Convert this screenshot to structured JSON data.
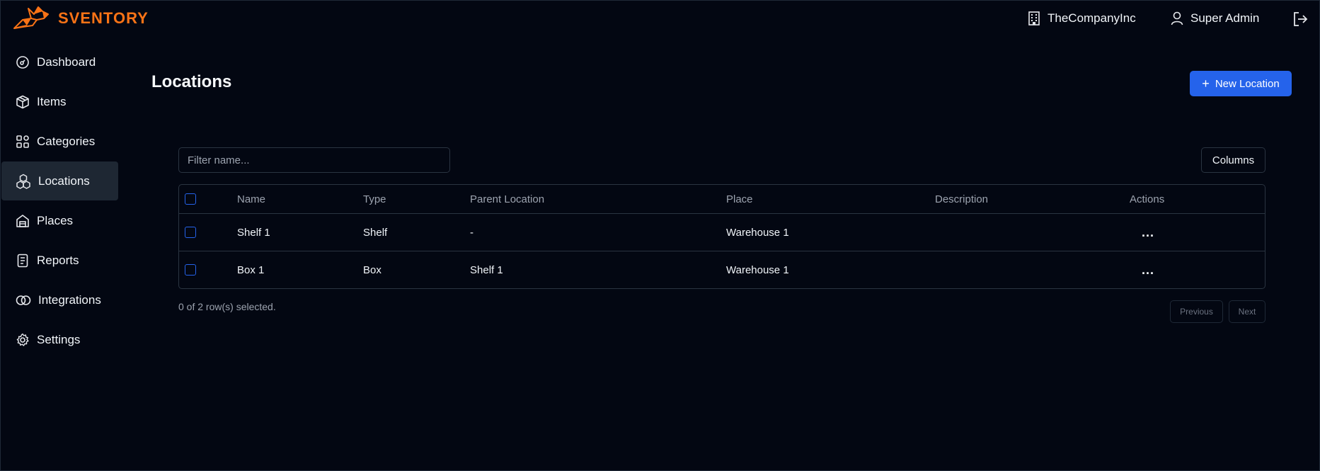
{
  "brand": {
    "name": "SVENTORY",
    "color": "#f97316"
  },
  "header": {
    "company": "TheCompanyInc",
    "user": "Super Admin",
    "icons": {
      "company": "building-icon",
      "user": "user-icon",
      "logout": "logout-icon"
    }
  },
  "sidebar": {
    "items": [
      {
        "label": "Dashboard",
        "icon": "gauge-icon",
        "active": false
      },
      {
        "label": "Items",
        "icon": "box-icon",
        "active": false
      },
      {
        "label": "Categories",
        "icon": "grid-icon",
        "active": false
      },
      {
        "label": "Locations",
        "icon": "boxes-icon",
        "active": true
      },
      {
        "label": "Places",
        "icon": "warehouse-icon",
        "active": false
      },
      {
        "label": "Reports",
        "icon": "report-icon",
        "active": false
      },
      {
        "label": "Integrations",
        "icon": "link-icon",
        "active": false
      },
      {
        "label": "Settings",
        "icon": "gear-icon",
        "active": false
      }
    ]
  },
  "main": {
    "title": "Locations",
    "new_button": "New Location",
    "filter_placeholder": "Filter name...",
    "columns_button": "Columns",
    "table": {
      "headers": [
        "Name",
        "Type",
        "Parent Location",
        "Place",
        "Description",
        "Actions"
      ],
      "rows": [
        {
          "name": "Shelf 1",
          "type": "Shelf",
          "parent": "-",
          "place": "Warehouse 1",
          "description": "",
          "actions": "..."
        },
        {
          "name": "Box 1",
          "type": "Box",
          "parent": "Shelf 1",
          "place": "Warehouse 1",
          "description": "",
          "actions": "..."
        }
      ]
    },
    "selection_text": "0 of 2 row(s) selected.",
    "pagination": {
      "previous": "Previous",
      "next": "Next"
    }
  },
  "colors": {
    "accent": "#2563eb",
    "background": "#030712",
    "active_nav": "#1e2733"
  }
}
